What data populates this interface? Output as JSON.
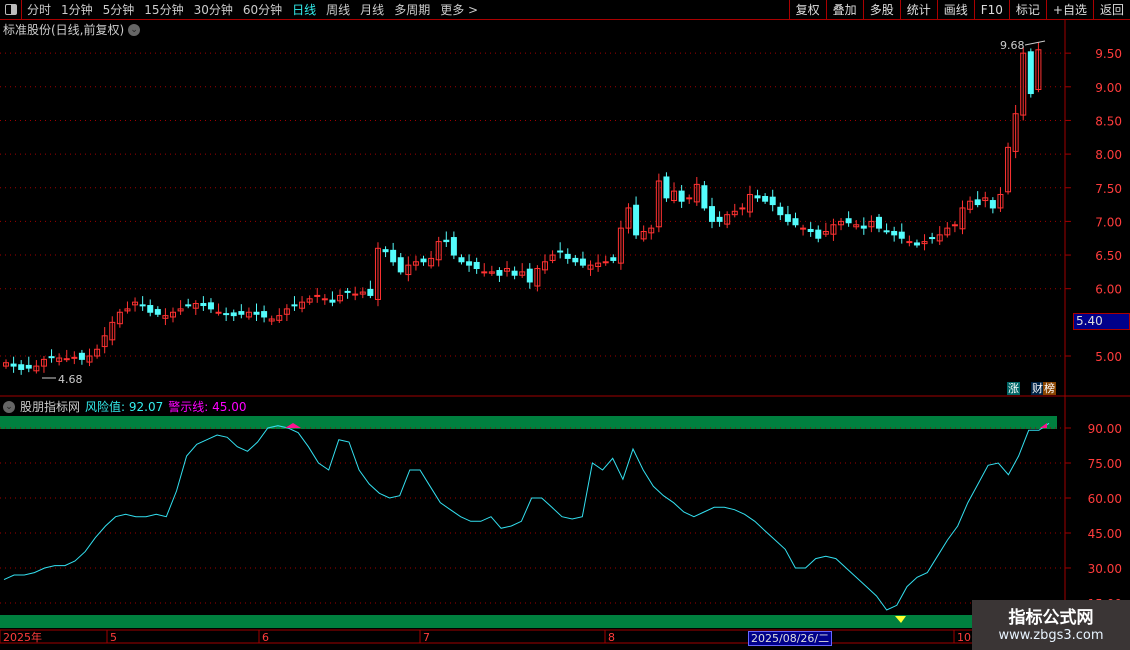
{
  "toolbar": {
    "periods": [
      "分时",
      "1分钟",
      "5分钟",
      "15分钟",
      "30分钟",
      "60分钟",
      "日线",
      "周线",
      "月线",
      "多周期",
      "更多 >"
    ],
    "active": "日线",
    "right_buttons": [
      "复权",
      "叠加",
      "多股",
      "统计",
      "画线",
      "F10",
      "标记",
      "+自选",
      "返回"
    ]
  },
  "main": {
    "title": "标准股份(日线,前复权)",
    "high_label": "9.68",
    "low_label": "4.68",
    "current_price": "5.40",
    "price_ticks": [
      "9.50",
      "9.00",
      "8.50",
      "8.00",
      "7.50",
      "7.00",
      "6.50",
      "6.00",
      "5.00"
    ],
    "badges": [
      "涨",
      "财",
      "榜"
    ],
    "closes": [
      4.9,
      4.85,
      4.8,
      4.82,
      4.85,
      4.95,
      4.98,
      4.97,
      4.96,
      4.98,
      4.95,
      5.0,
      5.1,
      5.3,
      5.5,
      5.65,
      5.7,
      5.8,
      5.75,
      5.65,
      5.62,
      5.6,
      5.65,
      5.7,
      5.75,
      5.78,
      5.75,
      5.7,
      5.65,
      5.62,
      5.6,
      5.62,
      5.65,
      5.62,
      5.58,
      5.55,
      5.6,
      5.7,
      5.75,
      5.8,
      5.85,
      5.9,
      5.85,
      5.8,
      5.9,
      5.95,
      5.92,
      5.95,
      5.9,
      6.6,
      6.55,
      6.4,
      6.25,
      6.35,
      6.4,
      6.4,
      6.45,
      6.7,
      6.7,
      6.5,
      6.4,
      6.35,
      6.3,
      6.25,
      6.25,
      6.2,
      6.3,
      6.2,
      6.25,
      6.1,
      6.3,
      6.4,
      6.5,
      6.55,
      6.45,
      6.4,
      6.35,
      6.35,
      6.38,
      6.4,
      6.42,
      6.9,
      7.2,
      6.8,
      6.85,
      6.9,
      7.6,
      7.35,
      7.45,
      7.3,
      7.35,
      7.55,
      7.2,
      7.0,
      7.0,
      7.1,
      7.15,
      7.2,
      7.4,
      7.35,
      7.3,
      7.25,
      7.1,
      7.0,
      6.95,
      6.9,
      6.85,
      6.75,
      6.85,
      6.95,
      7.0,
      6.98,
      6.95,
      6.9,
      7.0,
      6.9,
      6.85,
      6.8,
      6.75,
      6.7,
      6.65,
      6.7,
      6.75,
      6.8,
      6.9,
      6.95,
      7.2,
      7.3,
      7.25,
      7.35,
      7.2,
      7.4,
      8.1,
      8.6,
      9.5,
      8.9,
      9.55
    ]
  },
  "indicator": {
    "name": "股朋指标网",
    "risk_label": "风险值:",
    "risk_value": "92.07",
    "warn_label": "警示线:",
    "warn_value": "45.00",
    "ticks": [
      "90.00",
      "75.00",
      "60.00",
      "45.00",
      "30.00",
      "15.00"
    ],
    "values": [
      25,
      27,
      27,
      28,
      30,
      31,
      31,
      33,
      37,
      43,
      48,
      52,
      53,
      52,
      52,
      53,
      52,
      63,
      78,
      83,
      85,
      87,
      86,
      82,
      80,
      84,
      90,
      91,
      90,
      88,
      82,
      75,
      72,
      85,
      84,
      72,
      66,
      62,
      60,
      61,
      72,
      72,
      65,
      58,
      55,
      52,
      50,
      50,
      52,
      47,
      48,
      50,
      60,
      60,
      56,
      52,
      51,
      52,
      75,
      72,
      77,
      68,
      81,
      72,
      65,
      61,
      58,
      54,
      52,
      54,
      56,
      56,
      55,
      53,
      50,
      46,
      42,
      38,
      30,
      30,
      34,
      35,
      34,
      30,
      26,
      22,
      18,
      12,
      14,
      22,
      26,
      28,
      35,
      42,
      48,
      58,
      66,
      74,
      75,
      70,
      78,
      89,
      89,
      92
    ],
    "colors": {
      "line": "#33e0f0",
      "band": "#00803f",
      "top_mark": "#ff1090",
      "bottom_mark": "#ffff30"
    }
  },
  "xaxis": {
    "labels": [
      "2025年",
      "5",
      "6",
      "7",
      "8",
      "10"
    ],
    "cursor_date": "2025/08/26/二"
  },
  "watermark": {
    "title": "指标公式网",
    "url": "www.zbgs3.com"
  },
  "colors": {
    "up": "#ff3232",
    "down": "#54fcfc",
    "grid": "#a00000"
  }
}
